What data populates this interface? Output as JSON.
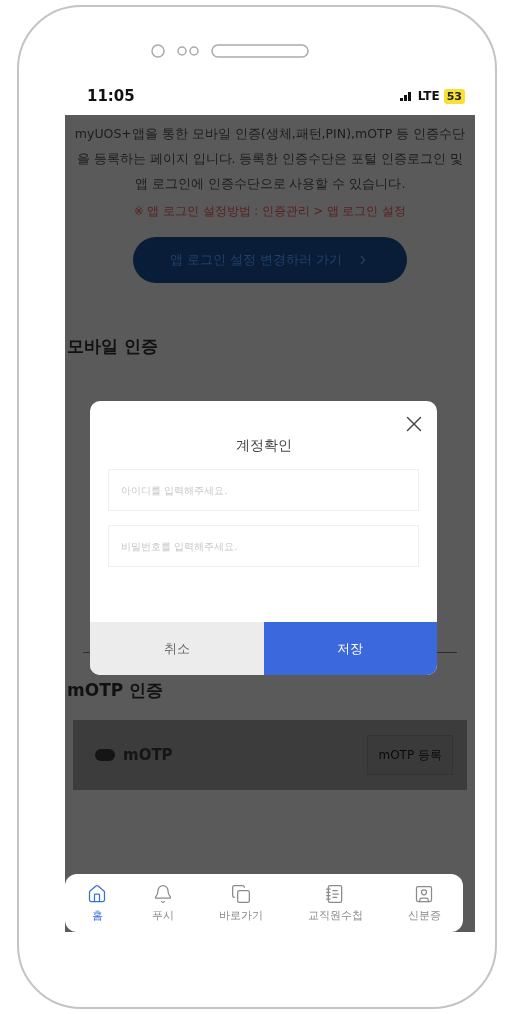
{
  "status_bar": {
    "time": "11:05",
    "network": "LTE",
    "battery": "53"
  },
  "intro": {
    "description": "myUOS+앱을 통한 모바일 인증(생체,패턴,PIN),mOTP 등 인증수단을 등록하는 페이지 입니다. 등록한 인증수단은 포털 인증로그인 및 앱 로그인에 인증수단으로 사용할 수 있습니다.",
    "notice": "※ 앱 로그인 설정방법 : 인증관리 > 앱 로그인 설정",
    "link_button": "앱 로그인 설정 변경하러 가기"
  },
  "mobile_section": {
    "title": "모바일 인증"
  },
  "motp_section": {
    "title": "mOTP 인증",
    "item_label": "mOTP",
    "item_button": "mOTP 등록"
  },
  "dialog": {
    "title": "계정확인",
    "fields": [
      {
        "placeholder": "아이디를 입력해주세요."
      },
      {
        "placeholder": "비밀번호를 입력해주세요."
      }
    ],
    "buttons": [
      {
        "label": "취소",
        "kind": "cancel"
      },
      {
        "label": "저장",
        "kind": "primary"
      }
    ]
  },
  "nav": [
    {
      "label": "홈",
      "selected": true
    },
    {
      "label": "푸시",
      "selected": false
    },
    {
      "label": "바로가기",
      "selected": false
    },
    {
      "label": "교직원수첩",
      "selected": false
    },
    {
      "label": "신분증",
      "selected": false
    }
  ]
}
